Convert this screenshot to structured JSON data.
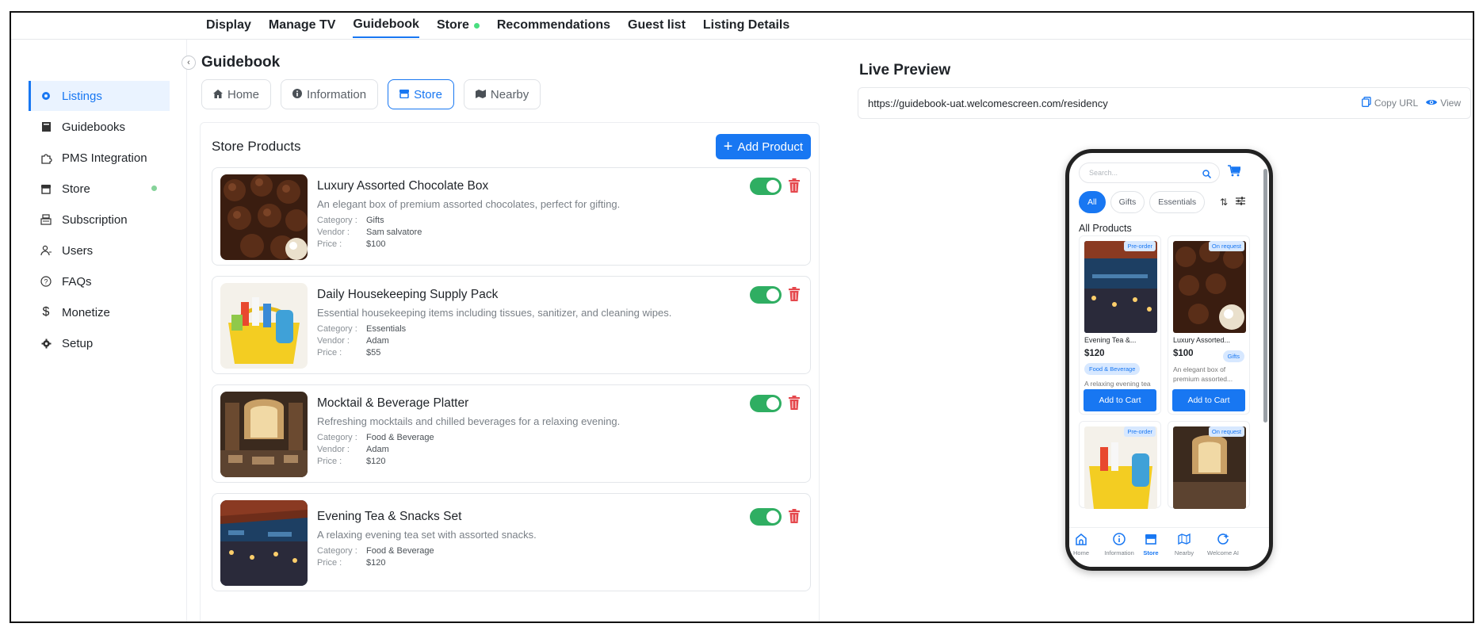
{
  "topnav": {
    "tabs": [
      "Display",
      "Manage TV",
      "Guidebook",
      "Store",
      "Recommendations",
      "Guest list",
      "Listing Details"
    ],
    "active": "Guidebook"
  },
  "sidebar": {
    "items": [
      {
        "label": "Listings",
        "icon": "listings-icon",
        "active": true
      },
      {
        "label": "Guidebooks",
        "icon": "book-icon"
      },
      {
        "label": "PMS Integration",
        "icon": "puzzle-icon"
      },
      {
        "label": "Store",
        "icon": "store-icon",
        "dot": true
      },
      {
        "label": "Subscription",
        "icon": "register-icon"
      },
      {
        "label": "Users",
        "icon": "users-icon"
      },
      {
        "label": "FAQs",
        "icon": "question-icon"
      },
      {
        "label": "Monetize",
        "icon": "dollar-icon"
      },
      {
        "label": "Setup",
        "icon": "gear-icon"
      }
    ]
  },
  "guidebook": {
    "title": "Guidebook",
    "tabs": [
      "Home",
      "Information",
      "Store",
      "Nearby"
    ],
    "active_tab": "Store"
  },
  "store": {
    "title": "Store Products",
    "add_label": "Add Product",
    "meta_labels": {
      "category": "Category :",
      "vendor": "Vendor :",
      "price": "Price :"
    },
    "products": [
      {
        "name": "Luxury Assorted Chocolate Box",
        "desc": "An elegant box of premium assorted chocolates, perfect for gifting.",
        "category": "Gifts",
        "vendor": "Sam salvatore",
        "price": "$100",
        "enabled": true
      },
      {
        "name": "Daily Housekeeping Supply Pack",
        "desc": "Essential housekeeping items including tissues, sanitizer, and cleaning wipes.",
        "category": "Essentials",
        "vendor": "Adam",
        "price": "$55",
        "enabled": true
      },
      {
        "name": "Mocktail & Beverage Platter",
        "desc": "Refreshing mocktails and chilled beverages for a relaxing evening.",
        "category": "Food & Beverage",
        "vendor": "Adam",
        "price": "$120",
        "enabled": true
      },
      {
        "name": "Evening Tea & Snacks Set",
        "desc": "A relaxing evening tea set with assorted snacks.",
        "category": "Food & Beverage",
        "price": "$120",
        "enabled": true
      }
    ]
  },
  "preview": {
    "title": "Live Preview",
    "url": "https://guidebook-uat.welcomescreen.com/residency",
    "copy_label": "Copy URL",
    "view_label": "View",
    "phone": {
      "search_placeholder": "Search...",
      "chips": [
        "All",
        "Gifts",
        "Essentials"
      ],
      "active_chip": "All",
      "section": "All Products",
      "cards": [
        {
          "badge": "Pre-order",
          "name": "Evening Tea &...",
          "price": "$120",
          "category": "Food & Beverage",
          "desc": "A relaxing evening tea set with...",
          "button": "Add to Cart"
        },
        {
          "badge": "On request",
          "name": "Luxury Assorted...",
          "price": "$100",
          "category": "Gifts",
          "desc": "An elegant box of premium assorted...",
          "button": "Add to Cart"
        },
        {
          "badge": "Pre-order"
        },
        {
          "badge": "On request"
        }
      ],
      "nav": [
        "Home",
        "Information",
        "Store",
        "Nearby",
        "Welcome AI"
      ],
      "nav_active": "Store"
    }
  },
  "colors": {
    "accent": "#1877f2",
    "toggle_on": "#2fae62",
    "delete": "#e5484d"
  }
}
